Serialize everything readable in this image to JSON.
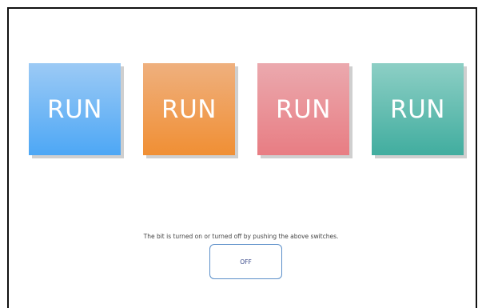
{
  "switches": [
    {
      "label": "RUN",
      "color": "#4da7f5"
    },
    {
      "label": "RUN",
      "color": "#f08f34"
    },
    {
      "label": "RUN",
      "color": "#e87d83"
    },
    {
      "label": "RUN",
      "color": "#41ad9f"
    }
  ],
  "hint_text": "The bit is turned on or turned off by pushing the above switches.",
  "status": {
    "label": "OFF",
    "border_color": "#5b8fc9"
  }
}
